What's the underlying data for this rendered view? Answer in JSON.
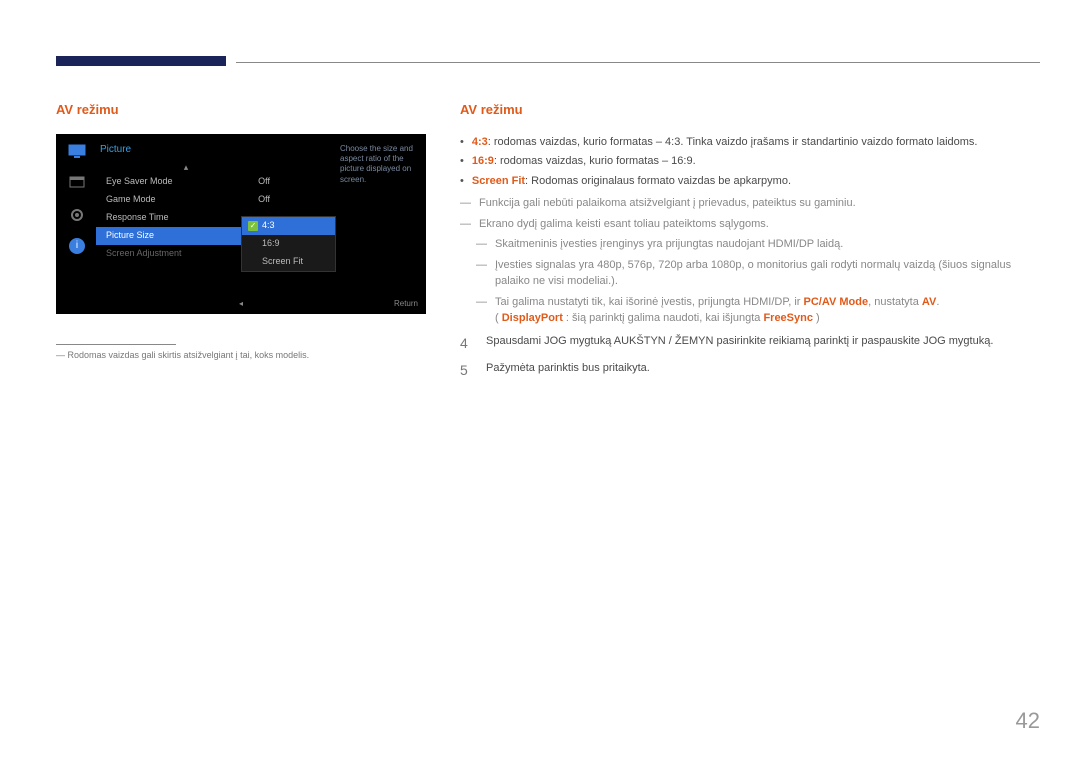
{
  "page_number": "42",
  "left": {
    "title": "AV režimu",
    "osd": {
      "heading": "Picture",
      "items": [
        {
          "label": "Eye Saver Mode",
          "value": "Off",
          "state": "normal"
        },
        {
          "label": "Game Mode",
          "value": "Off",
          "state": "normal"
        },
        {
          "label": "Response Time",
          "value": "",
          "state": "normal"
        },
        {
          "label": "Picture Size",
          "value": "",
          "state": "selected"
        },
        {
          "label": "Screen Adjustment",
          "value": "",
          "state": "disabled"
        }
      ],
      "sub_items": [
        {
          "label": "4:3",
          "checked": true,
          "selected": true
        },
        {
          "label": "16:9",
          "checked": false,
          "selected": false
        },
        {
          "label": "Screen Fit",
          "checked": false,
          "selected": false
        }
      ],
      "desc": "Choose the size and aspect ratio of the picture displayed on screen.",
      "return": "Return"
    },
    "footnote": "Rodomas vaizdas gali skirtis atsižvelgiant į tai, koks modelis."
  },
  "right": {
    "title": "AV režimu",
    "bullets": [
      {
        "lead": "4:3",
        "rest": ": rodomas vaizdas, kurio formatas – 4:3. Tinka vaizdo įrašams ir standartinio vaizdo formato laidoms."
      },
      {
        "lead": "16:9",
        "rest": ": rodomas vaizdas, kurio formatas – 16:9."
      },
      {
        "lead": "Screen Fit",
        "rest": ": Rodomas originalaus formato vaizdas be apkarpymo."
      }
    ],
    "dash1": "Funkcija gali nebūti palaikoma atsižvelgiant į prievadus, pateiktus su gaminiu.",
    "dash2": "Ekrano dydį galima keisti esant toliau pateiktoms sąlygoms.",
    "sub1": "Skaitmeninis įvesties įrenginys yra prijungtas naudojant HDMI/DP laidą.",
    "sub2": "Įvesties signalas yra 480p, 576p, 720p arba 1080p, o monitorius gali rodyti normalų vaizdą (šiuos signalus palaiko ne visi modeliai.).",
    "sub3_a": "Tai galima nustatyti tik, kai išorinė įvestis, prijungta HDMI/DP, ir ",
    "sub3_b": "PC/AV Mode",
    "sub3_c": ", nustatyta ",
    "sub3_d": "AV",
    "sub3_e": ".",
    "sub3_paren_a": "( ",
    "sub3_paren_b": "DisplayPort",
    "sub3_paren_c": " : šią parinktį galima naudoti, kai išjungta ",
    "sub3_paren_d": "FreeSync",
    "sub3_paren_e": " )",
    "step4_num": "4",
    "step4": "Spausdami JOG mygtuką AUKŠTYN / ŽEMYN pasirinkite reikiamą parinktį ir paspauskite JOG mygtuką.",
    "step5_num": "5",
    "step5": "Pažymėta parinktis bus pritaikyta."
  }
}
